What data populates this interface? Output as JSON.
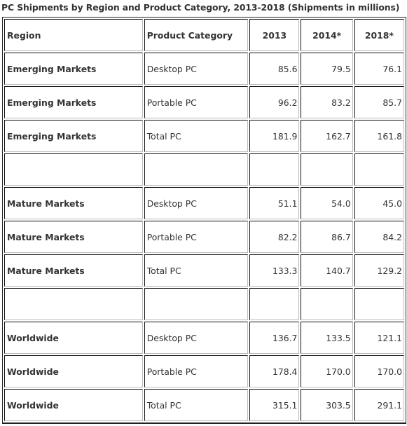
{
  "title": "PC Shipments by Region and Product Category, 2013-2018 (Shipments in millions)",
  "columns": [
    "Region",
    "Product Category",
    "2013",
    "2014*",
    "2018*"
  ],
  "rows": [
    [
      "Emerging Markets",
      "Desktop PC",
      "85.6",
      "79.5",
      "76.1"
    ],
    [
      "Emerging Markets",
      "Portable PC",
      "96.2",
      "83.2",
      "85.7"
    ],
    [
      "Emerging Markets",
      "Total PC",
      "181.9",
      "162.7",
      "161.8"
    ],
    [
      "",
      "",
      "",
      "",
      ""
    ],
    [
      "Mature Markets",
      "Desktop PC",
      "51.1",
      "54.0",
      "45.0"
    ],
    [
      "Mature Markets",
      "Portable PC",
      "82.2",
      "86.7",
      "84.2"
    ],
    [
      "Mature Markets",
      "Total PC",
      "133.3",
      "140.7",
      "129.2"
    ],
    [
      "",
      "",
      "",
      "",
      ""
    ],
    [
      "Worldwide",
      "Desktop PC",
      "136.7",
      "133.5",
      "121.1"
    ],
    [
      "Worldwide",
      "Portable PC",
      "178.4",
      "170.0",
      "170.0"
    ],
    [
      "Worldwide",
      "Total PC",
      "315.1",
      "303.5",
      "291.1"
    ]
  ]
}
